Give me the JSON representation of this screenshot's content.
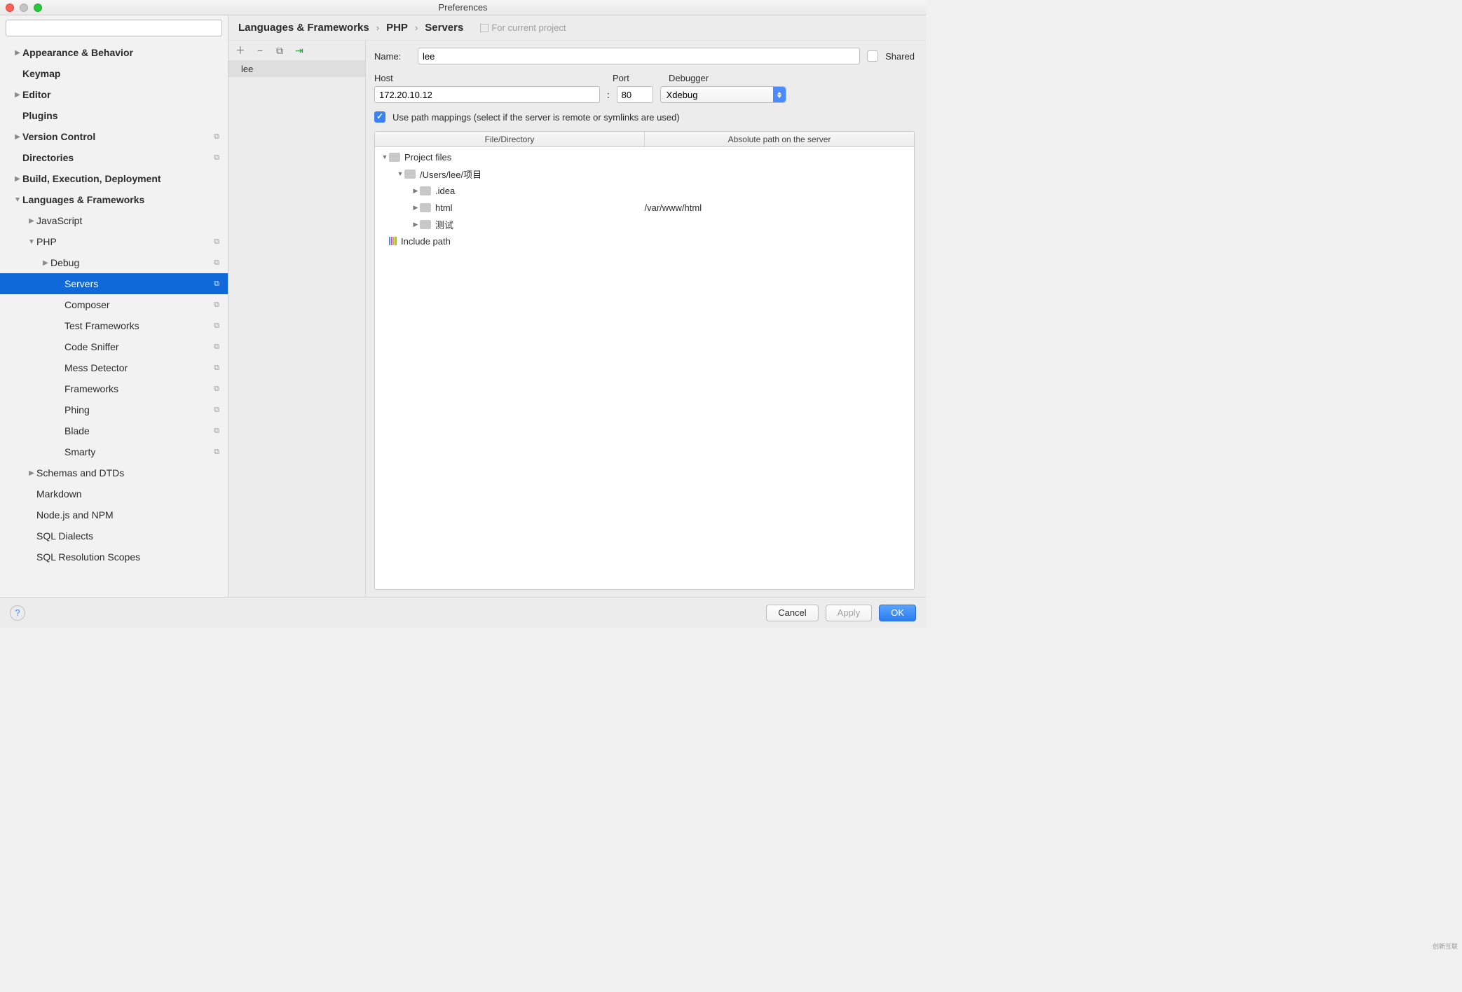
{
  "window": {
    "title": "Preferences"
  },
  "search": {
    "placeholder": ""
  },
  "sidebar": {
    "items": [
      {
        "label": "Appearance & Behavior",
        "chevron": "▶",
        "bold": true,
        "depth": 0
      },
      {
        "label": "Keymap",
        "bold": true,
        "depth": 0,
        "noexp": true
      },
      {
        "label": "Editor",
        "chevron": "▶",
        "bold": true,
        "depth": 0
      },
      {
        "label": "Plugins",
        "bold": true,
        "depth": 0,
        "noexp": true
      },
      {
        "label": "Version Control",
        "chevron": "▶",
        "bold": true,
        "depth": 0,
        "copy": true
      },
      {
        "label": "Directories",
        "bold": true,
        "depth": 0,
        "noexp": true,
        "copy": true
      },
      {
        "label": "Build, Execution, Deployment",
        "chevron": "▶",
        "bold": true,
        "depth": 0
      },
      {
        "label": "Languages & Frameworks",
        "chevron": "▼",
        "bold": true,
        "depth": 0
      },
      {
        "label": "JavaScript",
        "chevron": "▶",
        "depth": 1
      },
      {
        "label": "PHP",
        "chevron": "▼",
        "depth": 1,
        "copy": true
      },
      {
        "label": "Debug",
        "chevron": "▶",
        "depth": 2,
        "copy": true
      },
      {
        "label": "Servers",
        "depth": 3,
        "noexp": true,
        "copy": true,
        "selected": true
      },
      {
        "label": "Composer",
        "depth": 3,
        "noexp": true,
        "copy": true
      },
      {
        "label": "Test Frameworks",
        "depth": 3,
        "noexp": true,
        "copy": true
      },
      {
        "label": "Code Sniffer",
        "depth": 3,
        "noexp": true,
        "copy": true
      },
      {
        "label": "Mess Detector",
        "depth": 3,
        "noexp": true,
        "copy": true
      },
      {
        "label": "Frameworks",
        "depth": 3,
        "noexp": true,
        "copy": true
      },
      {
        "label": "Phing",
        "depth": 3,
        "noexp": true,
        "copy": true
      },
      {
        "label": "Blade",
        "depth": 3,
        "noexp": true,
        "copy": true
      },
      {
        "label": "Smarty",
        "depth": 3,
        "noexp": true,
        "copy": true
      },
      {
        "label": "Schemas and DTDs",
        "chevron": "▶",
        "depth": 1
      },
      {
        "label": "Markdown",
        "depth": 1,
        "noexp": true
      },
      {
        "label": "Node.js and NPM",
        "depth": 1,
        "noexp": true
      },
      {
        "label": "SQL Dialects",
        "depth": 1,
        "noexp": true
      },
      {
        "label": "SQL Resolution Scopes",
        "depth": 1,
        "noexp": true
      }
    ]
  },
  "breadcrumb": {
    "segs": [
      "Languages & Frameworks",
      "PHP",
      "Servers"
    ],
    "note": "For current project"
  },
  "servers_list": {
    "items": [
      "lee"
    ]
  },
  "form": {
    "name_label": "Name:",
    "name_value": "lee",
    "shared_label": "Shared",
    "shared_checked": false,
    "host_label": "Host",
    "host_value": "172.20.10.12",
    "colon": ":",
    "port_label": "Port",
    "port_value": "80",
    "debugger_label": "Debugger",
    "debugger_value": "Xdebug",
    "mappings_checked": true,
    "mappings_label": "Use path mappings (select if the server is remote or symlinks are used)"
  },
  "grid": {
    "headers": [
      "File/Directory",
      "Absolute path on the server"
    ],
    "rows": [
      {
        "indent": 0,
        "chevron": "▼",
        "folder": true,
        "label": "Project files",
        "path": ""
      },
      {
        "indent": 1,
        "chevron": "▼",
        "folder": true,
        "label": "/Users/lee/项目",
        "path": ""
      },
      {
        "indent": 2,
        "chevron": "▶",
        "folder": true,
        "label": ".idea",
        "path": ""
      },
      {
        "indent": 2,
        "chevron": "▶",
        "folder": true,
        "label": "html",
        "path": "/var/www/html"
      },
      {
        "indent": 2,
        "chevron": "▶",
        "folder": true,
        "label": "测试",
        "path": ""
      },
      {
        "indent": 0,
        "chevron": "",
        "include": true,
        "label": "Include path",
        "path": ""
      }
    ]
  },
  "footer": {
    "cancel": "Cancel",
    "apply": "Apply",
    "ok": "OK"
  },
  "watermark": "创新互联"
}
